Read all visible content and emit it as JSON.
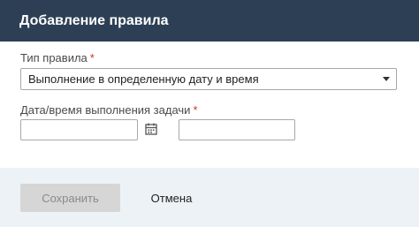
{
  "dialog": {
    "title": "Добавление правила"
  },
  "form": {
    "rule_type": {
      "label": "Тип правила",
      "required_mark": "*",
      "selected_value": "Выполнение в определенную дату и время"
    },
    "task_datetime": {
      "label": "Дата/время выполнения задачи",
      "required_mark": "*",
      "date_value": "",
      "time_value": "",
      "calendar_icon": "calendar-icon"
    }
  },
  "footer": {
    "save_label": "Сохранить",
    "cancel_label": "Отмена"
  },
  "colors": {
    "header_bg": "#2d3f55",
    "required": "#d32f2f",
    "footer_bg": "#edf2f6",
    "save_disabled_bg": "#d6d6d6"
  }
}
